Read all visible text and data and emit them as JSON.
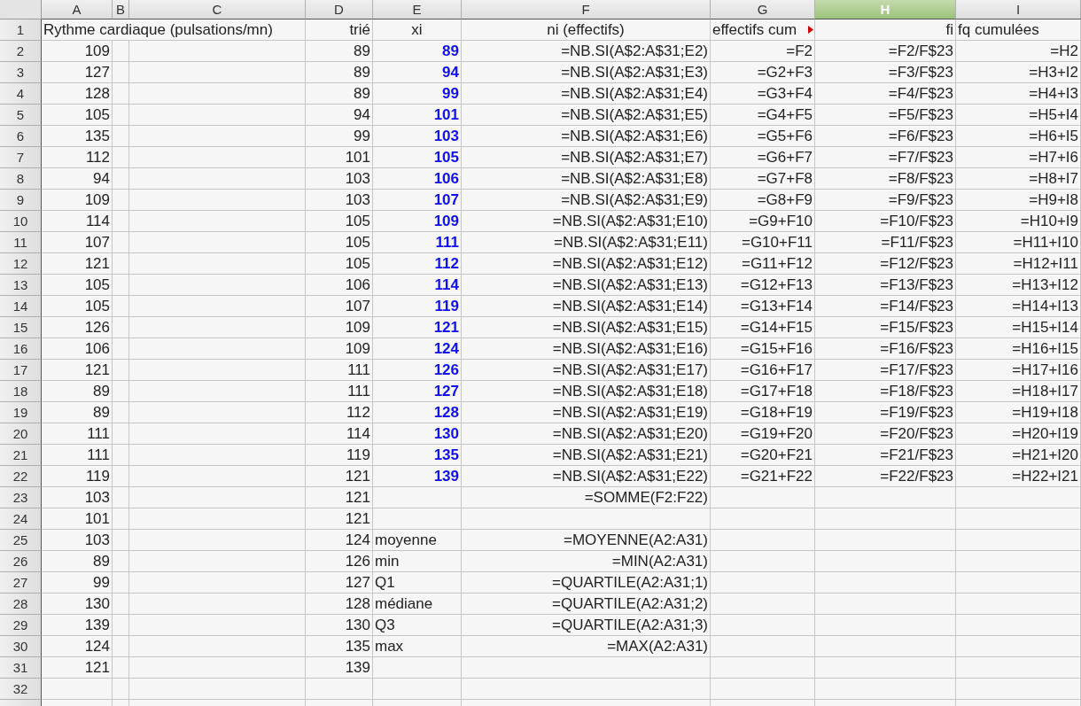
{
  "columns": [
    {
      "letter": "A",
      "selected": false
    },
    {
      "letter": "B",
      "selected": false
    },
    {
      "letter": "C",
      "selected": false
    },
    {
      "letter": "D",
      "selected": false
    },
    {
      "letter": "E",
      "selected": false
    },
    {
      "letter": "F",
      "selected": false
    },
    {
      "letter": "G",
      "selected": false
    },
    {
      "letter": "H",
      "selected": true
    },
    {
      "letter": "I",
      "selected": false
    }
  ],
  "rows": [
    {
      "number": "1",
      "cells": {
        "A": {
          "text": "Rythme cardiaque (pulsations/mn)",
          "kind": "label"
        },
        "D": {
          "text": "trié",
          "kind": "value"
        },
        "E": {
          "text": "xi",
          "kind": "centered"
        },
        "F": {
          "text": "ni (effectifs)",
          "kind": "centered"
        },
        "G": {
          "text": "effectifs cum",
          "kind": "label",
          "clipped": true
        },
        "H": {
          "text": "fi",
          "kind": "value"
        },
        "I": {
          "text": "fq cumulées",
          "kind": "label"
        }
      }
    },
    {
      "number": "2",
      "cells": {
        "A": {
          "text": "109",
          "kind": "value"
        },
        "D": {
          "text": "89",
          "kind": "value"
        },
        "E": {
          "text": "89",
          "kind": "key"
        },
        "F": {
          "text": "=NB.SI(A$2:A$31;E2)",
          "kind": "value"
        },
        "G": {
          "text": "=F2",
          "kind": "value"
        },
        "H": {
          "text": "=F2/F$23",
          "kind": "value"
        },
        "I": {
          "text": "=H2",
          "kind": "value"
        }
      }
    },
    {
      "number": "3",
      "cells": {
        "A": {
          "text": "127",
          "kind": "value"
        },
        "D": {
          "text": "89",
          "kind": "value"
        },
        "E": {
          "text": "94",
          "kind": "key"
        },
        "F": {
          "text": "=NB.SI(A$2:A$31;E3)",
          "kind": "value"
        },
        "G": {
          "text": "=G2+F3",
          "kind": "value"
        },
        "H": {
          "text": "=F3/F$23",
          "kind": "value"
        },
        "I": {
          "text": "=H3+I2",
          "kind": "value"
        }
      }
    },
    {
      "number": "4",
      "cells": {
        "A": {
          "text": "128",
          "kind": "value"
        },
        "D": {
          "text": "89",
          "kind": "value"
        },
        "E": {
          "text": "99",
          "kind": "key"
        },
        "F": {
          "text": "=NB.SI(A$2:A$31;E4)",
          "kind": "value"
        },
        "G": {
          "text": "=G3+F4",
          "kind": "value"
        },
        "H": {
          "text": "=F4/F$23",
          "kind": "value"
        },
        "I": {
          "text": "=H4+I3",
          "kind": "value"
        }
      }
    },
    {
      "number": "5",
      "cells": {
        "A": {
          "text": "105",
          "kind": "value"
        },
        "D": {
          "text": "94",
          "kind": "value"
        },
        "E": {
          "text": "101",
          "kind": "key"
        },
        "F": {
          "text": "=NB.SI(A$2:A$31;E5)",
          "kind": "value"
        },
        "G": {
          "text": "=G4+F5",
          "kind": "value"
        },
        "H": {
          "text": "=F5/F$23",
          "kind": "value"
        },
        "I": {
          "text": "=H5+I4",
          "kind": "value"
        }
      }
    },
    {
      "number": "6",
      "cells": {
        "A": {
          "text": "135",
          "kind": "value"
        },
        "D": {
          "text": "99",
          "kind": "value"
        },
        "E": {
          "text": "103",
          "kind": "key"
        },
        "F": {
          "text": "=NB.SI(A$2:A$31;E6)",
          "kind": "value"
        },
        "G": {
          "text": "=G5+F6",
          "kind": "value"
        },
        "H": {
          "text": "=F6/F$23",
          "kind": "value"
        },
        "I": {
          "text": "=H6+I5",
          "kind": "value"
        }
      }
    },
    {
      "number": "7",
      "cells": {
        "A": {
          "text": "112",
          "kind": "value"
        },
        "D": {
          "text": "101",
          "kind": "value"
        },
        "E": {
          "text": "105",
          "kind": "key"
        },
        "F": {
          "text": "=NB.SI(A$2:A$31;E7)",
          "kind": "value"
        },
        "G": {
          "text": "=G6+F7",
          "kind": "value"
        },
        "H": {
          "text": "=F7/F$23",
          "kind": "value"
        },
        "I": {
          "text": "=H7+I6",
          "kind": "value"
        }
      }
    },
    {
      "number": "8",
      "cells": {
        "A": {
          "text": "94",
          "kind": "value"
        },
        "D": {
          "text": "103",
          "kind": "value"
        },
        "E": {
          "text": "106",
          "kind": "key"
        },
        "F": {
          "text": "=NB.SI(A$2:A$31;E8)",
          "kind": "value"
        },
        "G": {
          "text": "=G7+F8",
          "kind": "value"
        },
        "H": {
          "text": "=F8/F$23",
          "kind": "value"
        },
        "I": {
          "text": "=H8+I7",
          "kind": "value"
        }
      }
    },
    {
      "number": "9",
      "cells": {
        "A": {
          "text": "109",
          "kind": "value"
        },
        "D": {
          "text": "103",
          "kind": "value"
        },
        "E": {
          "text": "107",
          "kind": "key"
        },
        "F": {
          "text": "=NB.SI(A$2:A$31;E9)",
          "kind": "value"
        },
        "G": {
          "text": "=G8+F9",
          "kind": "value"
        },
        "H": {
          "text": "=F9/F$23",
          "kind": "value"
        },
        "I": {
          "text": "=H9+I8",
          "kind": "value"
        }
      }
    },
    {
      "number": "10",
      "cells": {
        "A": {
          "text": "114",
          "kind": "value"
        },
        "D": {
          "text": "105",
          "kind": "value"
        },
        "E": {
          "text": "109",
          "kind": "key"
        },
        "F": {
          "text": "=NB.SI(A$2:A$31;E10)",
          "kind": "value"
        },
        "G": {
          "text": "=G9+F10",
          "kind": "value"
        },
        "H": {
          "text": "=F10/F$23",
          "kind": "value"
        },
        "I": {
          "text": "=H10+I9",
          "kind": "value"
        }
      }
    },
    {
      "number": "11",
      "cells": {
        "A": {
          "text": "107",
          "kind": "value"
        },
        "D": {
          "text": "105",
          "kind": "value"
        },
        "E": {
          "text": "111",
          "kind": "key"
        },
        "F": {
          "text": "=NB.SI(A$2:A$31;E11)",
          "kind": "value"
        },
        "G": {
          "text": "=G10+F11",
          "kind": "value"
        },
        "H": {
          "text": "=F11/F$23",
          "kind": "value"
        },
        "I": {
          "text": "=H11+I10",
          "kind": "value"
        }
      }
    },
    {
      "number": "12",
      "cells": {
        "A": {
          "text": "121",
          "kind": "value"
        },
        "D": {
          "text": "105",
          "kind": "value"
        },
        "E": {
          "text": "112",
          "kind": "key"
        },
        "F": {
          "text": "=NB.SI(A$2:A$31;E12)",
          "kind": "value"
        },
        "G": {
          "text": "=G11+F12",
          "kind": "value"
        },
        "H": {
          "text": "=F12/F$23",
          "kind": "value"
        },
        "I": {
          "text": "=H12+I11",
          "kind": "value"
        }
      }
    },
    {
      "number": "13",
      "cells": {
        "A": {
          "text": "105",
          "kind": "value"
        },
        "D": {
          "text": "106",
          "kind": "value"
        },
        "E": {
          "text": "114",
          "kind": "key"
        },
        "F": {
          "text": "=NB.SI(A$2:A$31;E13)",
          "kind": "value"
        },
        "G": {
          "text": "=G12+F13",
          "kind": "value"
        },
        "H": {
          "text": "=F13/F$23",
          "kind": "value"
        },
        "I": {
          "text": "=H13+I12",
          "kind": "value"
        }
      }
    },
    {
      "number": "14",
      "cells": {
        "A": {
          "text": "105",
          "kind": "value"
        },
        "D": {
          "text": "107",
          "kind": "value"
        },
        "E": {
          "text": "119",
          "kind": "key"
        },
        "F": {
          "text": "=NB.SI(A$2:A$31;E14)",
          "kind": "value"
        },
        "G": {
          "text": "=G13+F14",
          "kind": "value"
        },
        "H": {
          "text": "=F14/F$23",
          "kind": "value"
        },
        "I": {
          "text": "=H14+I13",
          "kind": "value"
        }
      }
    },
    {
      "number": "15",
      "cells": {
        "A": {
          "text": "126",
          "kind": "value"
        },
        "D": {
          "text": "109",
          "kind": "value"
        },
        "E": {
          "text": "121",
          "kind": "key"
        },
        "F": {
          "text": "=NB.SI(A$2:A$31;E15)",
          "kind": "value"
        },
        "G": {
          "text": "=G14+F15",
          "kind": "value"
        },
        "H": {
          "text": "=F15/F$23",
          "kind": "value"
        },
        "I": {
          "text": "=H15+I14",
          "kind": "value"
        }
      }
    },
    {
      "number": "16",
      "cells": {
        "A": {
          "text": "106",
          "kind": "value"
        },
        "D": {
          "text": "109",
          "kind": "value"
        },
        "E": {
          "text": "124",
          "kind": "key"
        },
        "F": {
          "text": "=NB.SI(A$2:A$31;E16)",
          "kind": "value"
        },
        "G": {
          "text": "=G15+F16",
          "kind": "value"
        },
        "H": {
          "text": "=F16/F$23",
          "kind": "value"
        },
        "I": {
          "text": "=H16+I15",
          "kind": "value"
        }
      }
    },
    {
      "number": "17",
      "cells": {
        "A": {
          "text": "121",
          "kind": "value"
        },
        "D": {
          "text": "111",
          "kind": "value"
        },
        "E": {
          "text": "126",
          "kind": "key"
        },
        "F": {
          "text": "=NB.SI(A$2:A$31;E17)",
          "kind": "value"
        },
        "G": {
          "text": "=G16+F17",
          "kind": "value"
        },
        "H": {
          "text": "=F17/F$23",
          "kind": "value"
        },
        "I": {
          "text": "=H17+I16",
          "kind": "value"
        }
      }
    },
    {
      "number": "18",
      "cells": {
        "A": {
          "text": "89",
          "kind": "value"
        },
        "D": {
          "text": "111",
          "kind": "value"
        },
        "E": {
          "text": "127",
          "kind": "key"
        },
        "F": {
          "text": "=NB.SI(A$2:A$31;E18)",
          "kind": "value"
        },
        "G": {
          "text": "=G17+F18",
          "kind": "value"
        },
        "H": {
          "text": "=F18/F$23",
          "kind": "value"
        },
        "I": {
          "text": "=H18+I17",
          "kind": "value"
        }
      }
    },
    {
      "number": "19",
      "cells": {
        "A": {
          "text": "89",
          "kind": "value"
        },
        "D": {
          "text": "112",
          "kind": "value"
        },
        "E": {
          "text": "128",
          "kind": "key"
        },
        "F": {
          "text": "=NB.SI(A$2:A$31;E19)",
          "kind": "value"
        },
        "G": {
          "text": "=G18+F19",
          "kind": "value"
        },
        "H": {
          "text": "=F19/F$23",
          "kind": "value"
        },
        "I": {
          "text": "=H19+I18",
          "kind": "value"
        }
      }
    },
    {
      "number": "20",
      "cells": {
        "A": {
          "text": "111",
          "kind": "value"
        },
        "D": {
          "text": "114",
          "kind": "value"
        },
        "E": {
          "text": "130",
          "kind": "key"
        },
        "F": {
          "text": "=NB.SI(A$2:A$31;E20)",
          "kind": "value"
        },
        "G": {
          "text": "=G19+F20",
          "kind": "value"
        },
        "H": {
          "text": "=F20/F$23",
          "kind": "value"
        },
        "I": {
          "text": "=H20+I19",
          "kind": "value"
        }
      }
    },
    {
      "number": "21",
      "cells": {
        "A": {
          "text": "111",
          "kind": "value"
        },
        "D": {
          "text": "119",
          "kind": "value"
        },
        "E": {
          "text": "135",
          "kind": "key"
        },
        "F": {
          "text": "=NB.SI(A$2:A$31;E21)",
          "kind": "value"
        },
        "G": {
          "text": "=G20+F21",
          "kind": "value"
        },
        "H": {
          "text": "=F21/F$23",
          "kind": "value"
        },
        "I": {
          "text": "=H21+I20",
          "kind": "value"
        }
      }
    },
    {
      "number": "22",
      "cells": {
        "A": {
          "text": "119",
          "kind": "value"
        },
        "D": {
          "text": "121",
          "kind": "value"
        },
        "E": {
          "text": "139",
          "kind": "key"
        },
        "F": {
          "text": "=NB.SI(A$2:A$31;E22)",
          "kind": "value"
        },
        "G": {
          "text": "=G21+F22",
          "kind": "value"
        },
        "H": {
          "text": "=F22/F$23",
          "kind": "value"
        },
        "I": {
          "text": "=H22+I21",
          "kind": "value"
        }
      }
    },
    {
      "number": "23",
      "cells": {
        "A": {
          "text": "103",
          "kind": "value"
        },
        "D": {
          "text": "121",
          "kind": "value"
        },
        "F": {
          "text": "=SOMME(F2:F22)",
          "kind": "value"
        }
      }
    },
    {
      "number": "24",
      "cells": {
        "A": {
          "text": "101",
          "kind": "value"
        },
        "D": {
          "text": "121",
          "kind": "value"
        }
      }
    },
    {
      "number": "25",
      "cells": {
        "A": {
          "text": "103",
          "kind": "value"
        },
        "D": {
          "text": "124",
          "kind": "value"
        },
        "E": {
          "text": "moyenne",
          "kind": "label"
        },
        "F": {
          "text": "=MOYENNE(A2:A31)",
          "kind": "value"
        }
      }
    },
    {
      "number": "26",
      "cells": {
        "A": {
          "text": "89",
          "kind": "value"
        },
        "D": {
          "text": "126",
          "kind": "value"
        },
        "E": {
          "text": "min",
          "kind": "label"
        },
        "F": {
          "text": "=MIN(A2:A31)",
          "kind": "value"
        }
      }
    },
    {
      "number": "27",
      "cells": {
        "A": {
          "text": "99",
          "kind": "value"
        },
        "D": {
          "text": "127",
          "kind": "value"
        },
        "E": {
          "text": "Q1",
          "kind": "label"
        },
        "F": {
          "text": "=QUARTILE(A2:A31;1)",
          "kind": "value"
        }
      }
    },
    {
      "number": "28",
      "cells": {
        "A": {
          "text": "130",
          "kind": "value"
        },
        "D": {
          "text": "128",
          "kind": "value"
        },
        "E": {
          "text": "médiane",
          "kind": "label"
        },
        "F": {
          "text": "=QUARTILE(A2:A31;2)",
          "kind": "value"
        }
      }
    },
    {
      "number": "29",
      "cells": {
        "A": {
          "text": "139",
          "kind": "value"
        },
        "D": {
          "text": "130",
          "kind": "value"
        },
        "E": {
          "text": "Q3",
          "kind": "label"
        },
        "F": {
          "text": "=QUARTILE(A2:A31;3)",
          "kind": "value"
        }
      }
    },
    {
      "number": "30",
      "cells": {
        "A": {
          "text": "124",
          "kind": "value"
        },
        "D": {
          "text": "135",
          "kind": "value"
        },
        "E": {
          "text": "max",
          "kind": "label"
        },
        "F": {
          "text": "=MAX(A2:A31)",
          "kind": "value"
        }
      }
    },
    {
      "number": "31",
      "cells": {
        "A": {
          "text": "121",
          "kind": "value"
        },
        "D": {
          "text": "139",
          "kind": "value"
        }
      }
    },
    {
      "number": "32",
      "cells": {}
    }
  ]
}
